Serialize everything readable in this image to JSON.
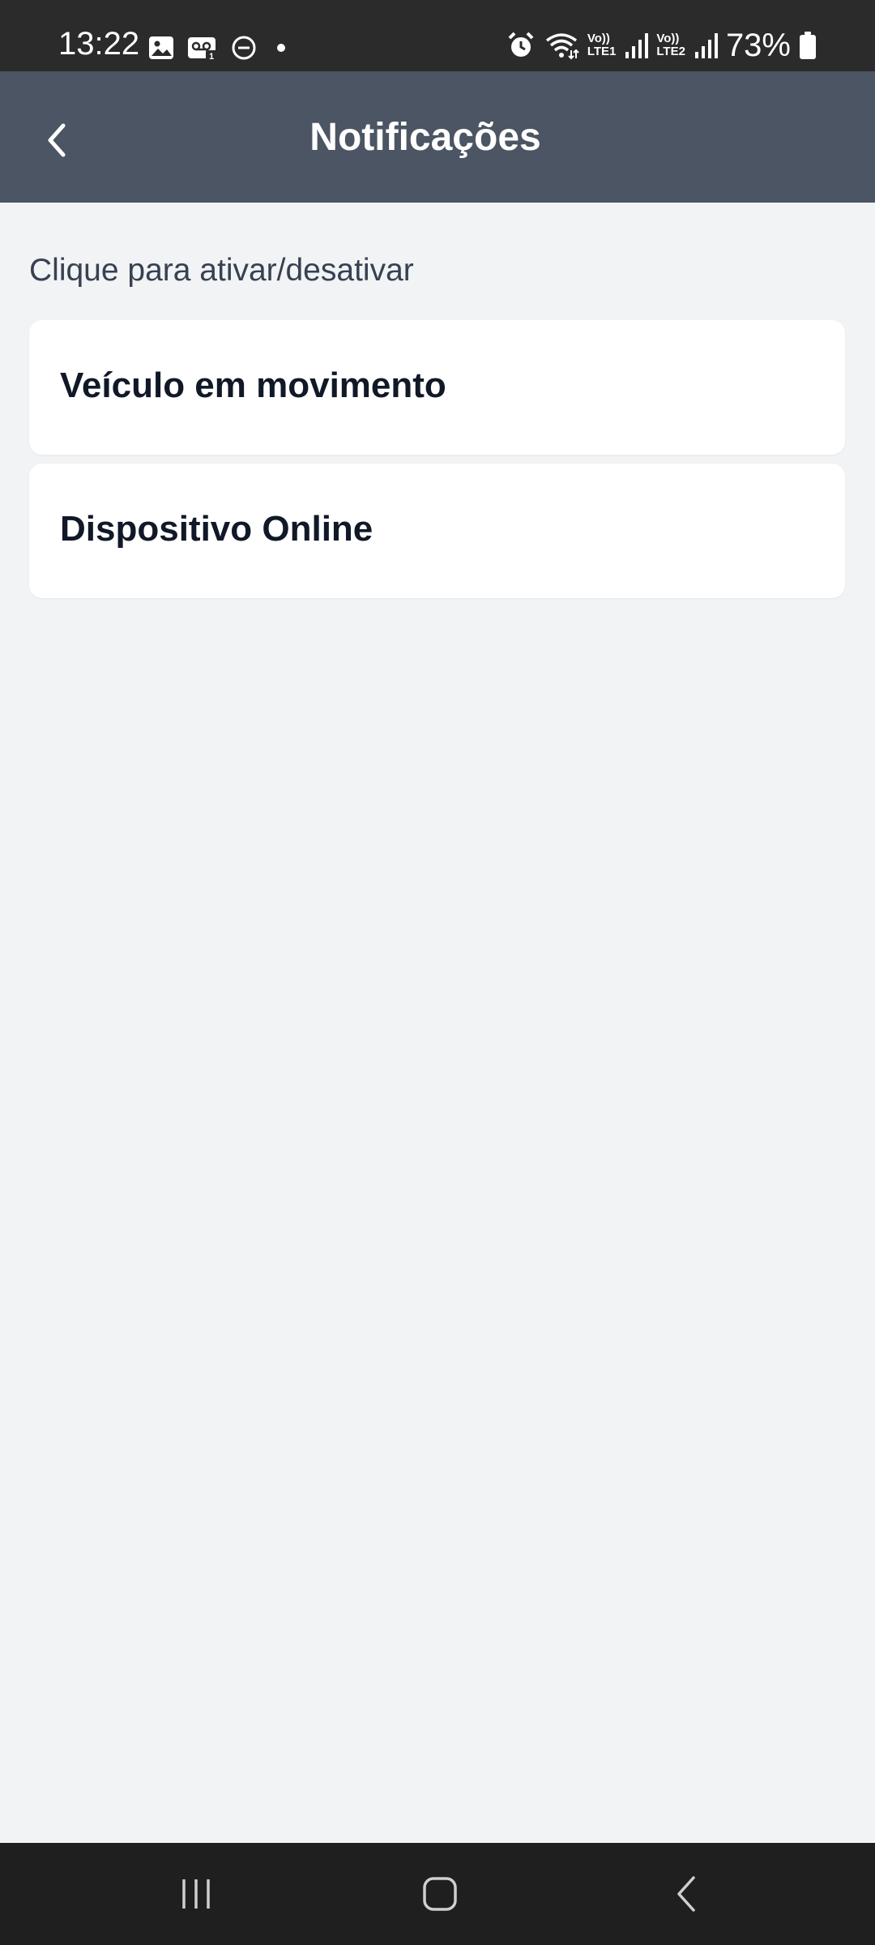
{
  "status_bar": {
    "time": "13:22",
    "battery_percent": "73%",
    "sim1_label": "Vo))",
    "sim1_sub": "LTE1",
    "sim2_label": "Vo))",
    "sim2_sub": "LTE2",
    "icons_left": [
      "image-icon",
      "voicemail-icon",
      "do-not-disturb-icon",
      "dot-icon"
    ],
    "icons_right": [
      "alarm-icon",
      "wifi-icon",
      "signal-icon",
      "signal-icon",
      "battery-icon"
    ]
  },
  "header": {
    "title": "Notificações",
    "background": "#4b5563"
  },
  "content": {
    "hint": "Clique para ativar/desativar",
    "items": [
      {
        "label": "Veículo em movimento"
      },
      {
        "label": "Dispositivo Online"
      }
    ]
  },
  "nav_bar": {
    "buttons": [
      "recent-apps-icon",
      "home-icon",
      "back-icon"
    ]
  }
}
